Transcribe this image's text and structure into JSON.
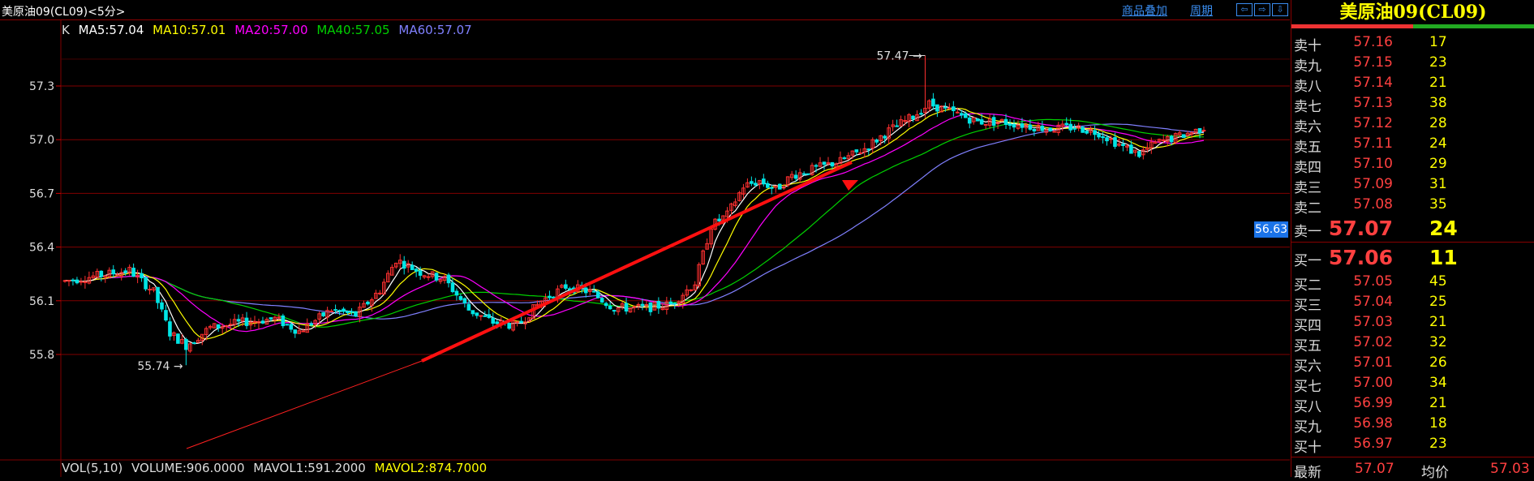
{
  "header": {
    "title": "美原油09(CL09)<5分>",
    "overlay_link": "商品叠加",
    "period_link": "周期",
    "nav_buttons": [
      "⇦",
      "⇨",
      "⇩"
    ]
  },
  "ma_legend": {
    "k": "K",
    "ma5": "MA5:57.04",
    "ma10": "MA10:57.01",
    "ma20": "MA20:57.00",
    "ma40": "MA40:57.05",
    "ma60": "MA60:57.07"
  },
  "vol_legend": {
    "vol": "VOL(5,10)",
    "volume": "VOLUME:906.0000",
    "mavol1": "MAVOL1:591.2000",
    "mavol2": "MAVOL2:874.7000"
  },
  "current_price_tag": "56.63",
  "colors": {
    "up": "#ff3030",
    "down": "#00e5e5",
    "ma5": "#ffffff",
    "ma10": "#ffff00",
    "ma20": "#ff00ff",
    "ma40": "#00d000",
    "ma60": "#8080ff",
    "grid": "#800000"
  },
  "chart_data": {
    "type": "candlestick",
    "yticks": [
      "57.3",
      "57.0",
      "56.7",
      "56.4",
      "56.1",
      "55.8"
    ],
    "ylim": [
      55.7,
      57.5
    ],
    "high_marker": "57.47",
    "low_marker": "55.74",
    "high_value": 57.47,
    "low_value": 55.74
  },
  "order_book": {
    "title": "美原油09(CL09)",
    "asks": [
      {
        "label": "卖十",
        "price": "57.16",
        "qty": "17"
      },
      {
        "label": "卖九",
        "price": "57.15",
        "qty": "23"
      },
      {
        "label": "卖八",
        "price": "57.14",
        "qty": "21"
      },
      {
        "label": "卖七",
        "price": "57.13",
        "qty": "38"
      },
      {
        "label": "卖六",
        "price": "57.12",
        "qty": "28"
      },
      {
        "label": "卖五",
        "price": "57.11",
        "qty": "24"
      },
      {
        "label": "卖四",
        "price": "57.10",
        "qty": "29"
      },
      {
        "label": "卖三",
        "price": "57.09",
        "qty": "31"
      },
      {
        "label": "卖二",
        "price": "57.08",
        "qty": "35"
      },
      {
        "label": "卖一",
        "price": "57.07",
        "qty": "24"
      }
    ],
    "bids": [
      {
        "label": "买一",
        "price": "57.06",
        "qty": "11"
      },
      {
        "label": "买二",
        "price": "57.05",
        "qty": "45"
      },
      {
        "label": "买三",
        "price": "57.04",
        "qty": "25"
      },
      {
        "label": "买四",
        "price": "57.03",
        "qty": "21"
      },
      {
        "label": "买五",
        "price": "57.02",
        "qty": "32"
      },
      {
        "label": "买六",
        "price": "57.01",
        "qty": "26"
      },
      {
        "label": "买七",
        "price": "57.00",
        "qty": "34"
      },
      {
        "label": "买八",
        "price": "56.99",
        "qty": "21"
      },
      {
        "label": "买九",
        "price": "56.98",
        "qty": "18"
      },
      {
        "label": "买十",
        "price": "56.97",
        "qty": "23"
      }
    ],
    "last_label": "最新",
    "last_value": "57.07",
    "avg_label": "均价",
    "avg_value": "57.03"
  }
}
